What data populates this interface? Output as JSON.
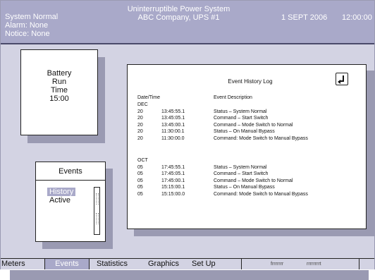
{
  "header": {
    "status_lines": [
      "System Normal",
      "Alarm: None",
      "Notice: None"
    ],
    "title": "Uninterruptible Power System",
    "subtitle": "ABC Company, UPS #1",
    "date": "1 SEPT 2006",
    "time": "12:00:00"
  },
  "battery": {
    "lines": [
      "Battery",
      "Run",
      "Time",
      "15:00"
    ]
  },
  "events_panel": {
    "title": "Events",
    "items": [
      "History",
      "Active"
    ],
    "selected": "History"
  },
  "log": {
    "title": "Event History Log",
    "col_datetime": "Date/Time",
    "col_description": "Event Description",
    "groups": [
      {
        "month": "DEC",
        "rows": [
          {
            "day": "20",
            "time": "13:45:55.1",
            "desc": "Status – System Normal"
          },
          {
            "day": "20",
            "time": "13:45:05.1",
            "desc": "Command – Start Switch"
          },
          {
            "day": "20",
            "time": "13:45:00.1",
            "desc": "Command – Mode Switch to Normal"
          },
          {
            "day": "20",
            "time": "11:30:00.1",
            "desc": "Status – On Manual Bypass"
          },
          {
            "day": "20",
            "time": "11:30:00.0",
            "desc": "Command:  Mode Switch to Manual Bypass"
          }
        ]
      },
      {
        "month": "OCT",
        "rows": [
          {
            "day": "05",
            "time": "17:45:55.1",
            "desc": "Status – System Normal"
          },
          {
            "day": "05",
            "time": "17:45:05.1",
            "desc": "Command – Start Switch"
          },
          {
            "day": "05",
            "time": "17:45:00.1",
            "desc": "Command – Mode Switch to Normal"
          },
          {
            "day": "05",
            "time": "15:15:00.1",
            "desc": "Status – On Manual Bypass"
          },
          {
            "day": "05",
            "time": "15:15:00.0",
            "desc": "Command:  Mode Switch to Manual Bypass"
          }
        ]
      }
    ],
    "return_icon": "return-arrow-icon"
  },
  "menubar": {
    "meters": "Meters",
    "events": "Events",
    "statistics": "Statistics",
    "graphics": "Graphics",
    "setup": "Set Up",
    "aux_1": "frrrrrrr",
    "aux_2": "rrrrrrrrt",
    "selected": "Events"
  },
  "colors": {
    "header_bg": "#a9a9c9",
    "body_bg": "#d3d3e3",
    "shadow": "#9a9ab2",
    "selected_bg": "#a9a9c9"
  }
}
